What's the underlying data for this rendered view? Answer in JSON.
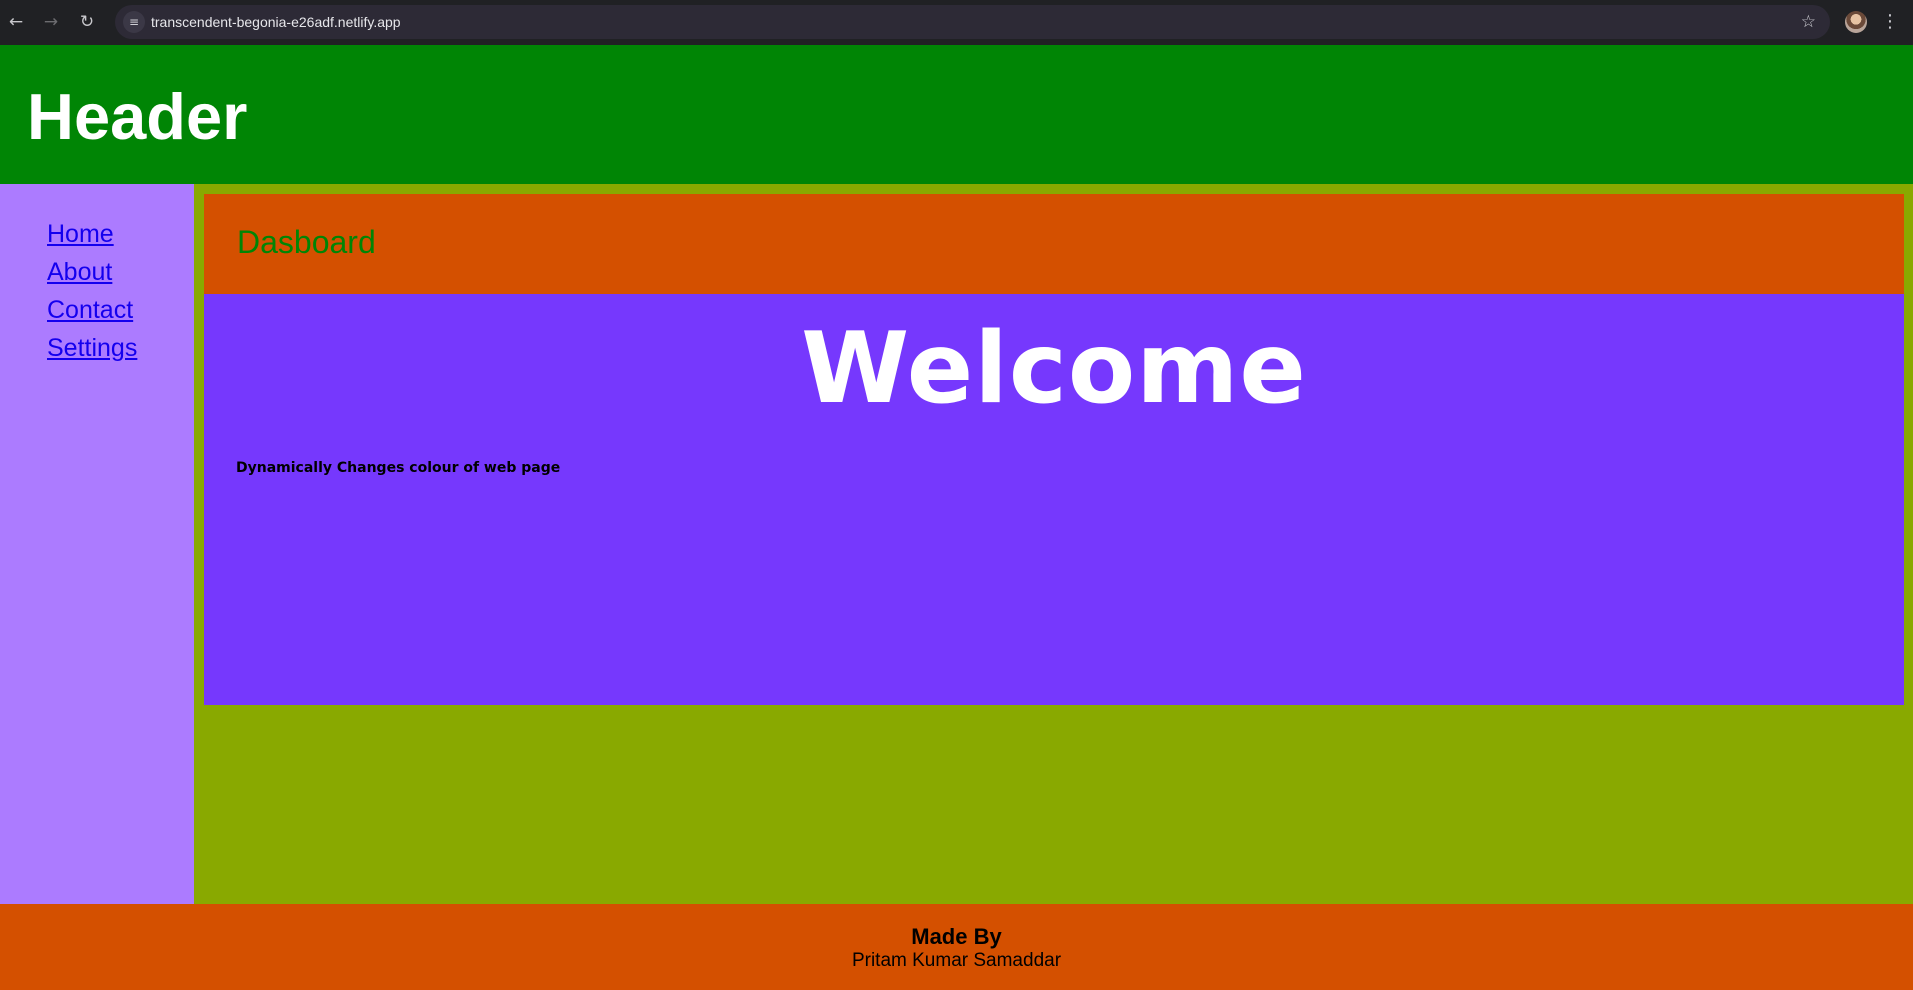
{
  "browser": {
    "back_icon": "back-arrow-icon",
    "forward_icon": "forward-arrow-icon",
    "reload_icon": "reload-icon",
    "site_info_icon": "tune-icon",
    "url": "transcendent-begonia-e26adf.netlify.app",
    "bookmark_icon": "star-icon",
    "profile_icon": "avatar",
    "menu_icon": "kebab-menu-icon"
  },
  "header": {
    "title": "Header",
    "background": "#008505"
  },
  "sidebar": {
    "background": "#ac7bff",
    "items": [
      {
        "label": "Home"
      },
      {
        "label": "About"
      },
      {
        "label": "Contact"
      },
      {
        "label": "Settings"
      }
    ]
  },
  "main": {
    "background": "#89a900",
    "dashboard_title": "Dasboard",
    "dashboard_background": "#d45000",
    "welcome_title": "Welcome",
    "welcome_text": "Dynamically Changes colour of web page",
    "welcome_background": "#7638fd"
  },
  "footer": {
    "background": "#d45000",
    "made_by_label": "Made By",
    "author": "Pritam Kumar Samaddar"
  }
}
